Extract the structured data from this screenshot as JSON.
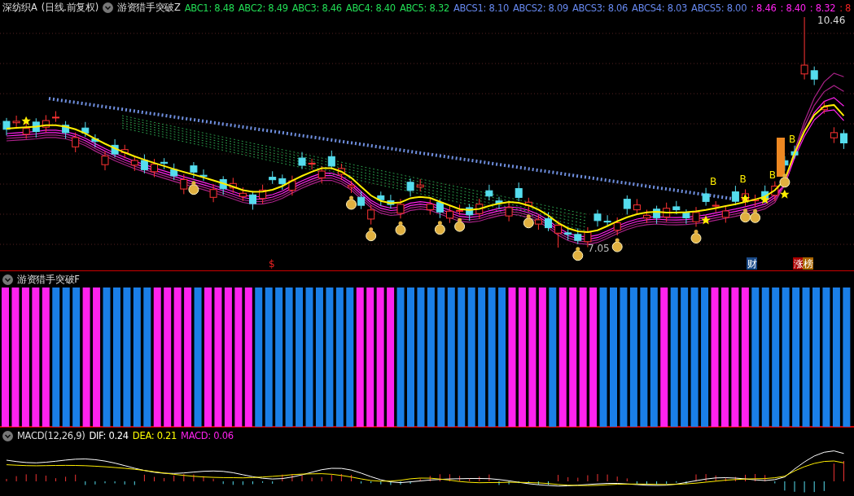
{
  "instrument": {
    "name": "深纺织A",
    "period": "(日线.前复权)"
  },
  "main_indicator": {
    "name": "游资猎手突破Z",
    "values": [
      {
        "label": "ABC1: 8.48",
        "color": "#22dd55"
      },
      {
        "label": "ABC2: 8.49",
        "color": "#22dd55"
      },
      {
        "label": "ABC3: 8.46",
        "color": "#22dd55"
      },
      {
        "label": "ABC4: 8.40",
        "color": "#22dd55"
      },
      {
        "label": "ABC5: 8.32",
        "color": "#22dd55"
      },
      {
        "label": "ABCS1: 8.10",
        "color": "#6688ee"
      },
      {
        "label": "ABCS2: 8.09",
        "color": "#6688ee"
      },
      {
        "label": "ABCS3: 8.06",
        "color": "#6688ee"
      },
      {
        "label": "ABCS4: 8.03",
        "color": "#6688ee"
      },
      {
        "label": "ABCS5: 8.00",
        "color": "#6688ee"
      },
      {
        "label": ": 8.46",
        "color": "#ff22ee"
      },
      {
        "label": ": 8.40",
        "color": "#ff22ee"
      },
      {
        "label": ": 8.32",
        "color": "#ff22ee"
      },
      {
        "label": ": 8",
        "color": "#ee2222"
      }
    ]
  },
  "price_labels": {
    "high": "10.46",
    "low": "7.05"
  },
  "signals": [
    "B",
    "B",
    "B",
    "B"
  ],
  "event_marks": [
    {
      "kind": "text",
      "label": "$",
      "color": "#ee2222"
    },
    {
      "kind": "badge",
      "label": "财",
      "color": "#1a4a88"
    },
    {
      "kind": "badge",
      "label": "涨",
      "color": "#aa0000"
    },
    {
      "kind": "badge",
      "label": "榜",
      "color": "#aa6600"
    }
  ],
  "sub_indicator": {
    "name": "游资猎手突破F"
  },
  "macd": {
    "name": "MACD(12,26,9)",
    "values": [
      {
        "label": "DIF: 0.24",
        "color": "#ffffff"
      },
      {
        "label": "DEA: 0.21",
        "color": "#ffff00"
      },
      {
        "label": "MACD: 0.06",
        "color": "#ff22ee"
      }
    ]
  }
}
